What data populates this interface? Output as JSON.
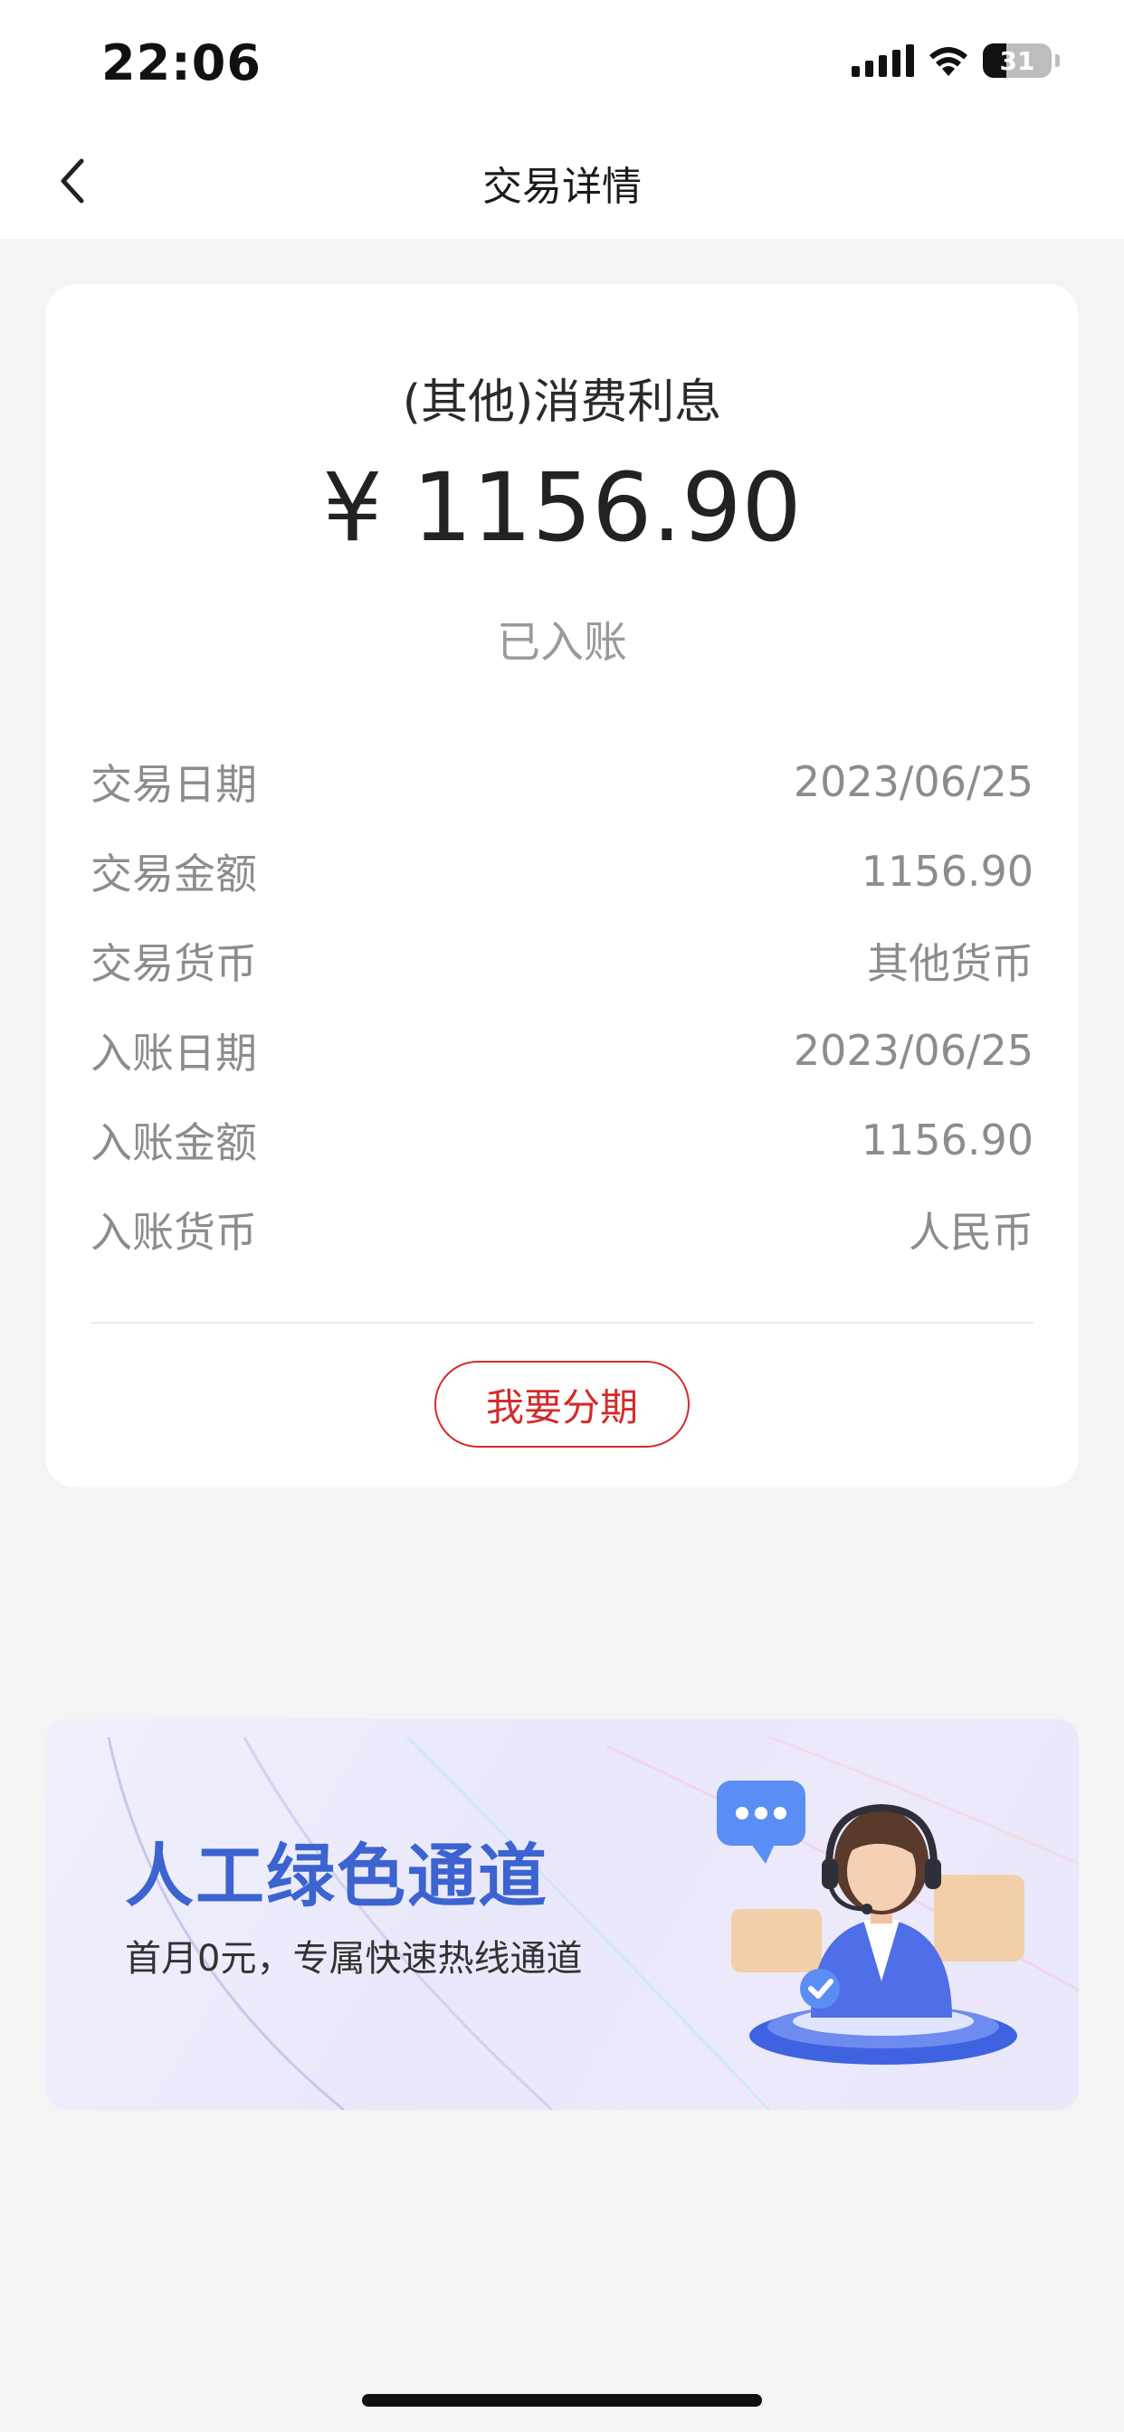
{
  "status_bar": {
    "time": "22:06",
    "battery": "31"
  },
  "nav": {
    "title": "交易详情",
    "back_icon": "chevron-left-icon"
  },
  "transaction": {
    "type": "(其他)消费利息",
    "amount": "¥ 1156.90",
    "status": "已入账",
    "details": [
      {
        "label": "交易日期",
        "value": "2023/06/25"
      },
      {
        "label": "交易金额",
        "value": "1156.90"
      },
      {
        "label": "交易货币",
        "value": "其他货币"
      },
      {
        "label": "入账日期",
        "value": "2023/06/25"
      },
      {
        "label": "入账金额",
        "value": "1156.90"
      },
      {
        "label": "入账货币",
        "value": "人民币"
      }
    ],
    "installment_button": "我要分期"
  },
  "banner": {
    "title": "人工绿色通道",
    "subtitle": "首月0元，专属快速热线通道",
    "illustration_icon": "customer-service-agent-icon"
  },
  "colors": {
    "accent_red": "#d42b2b",
    "banner_blue": "#3c63cf"
  }
}
